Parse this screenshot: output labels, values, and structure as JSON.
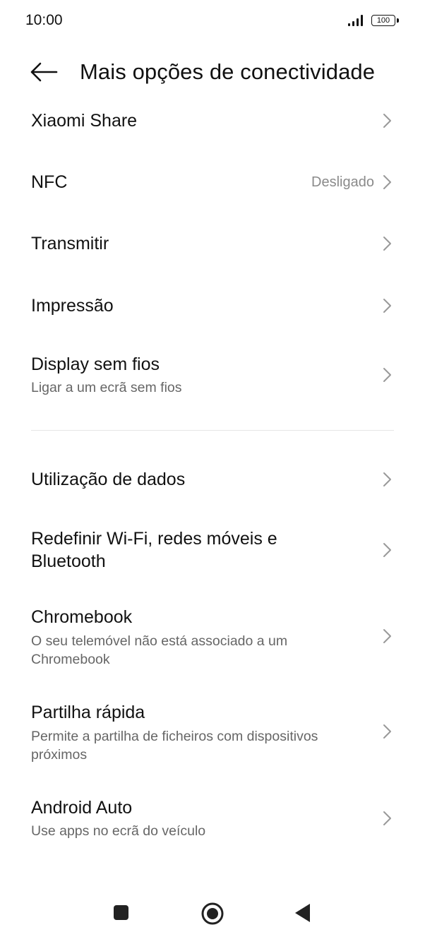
{
  "status_bar": {
    "time": "10:00",
    "battery": "100"
  },
  "header": {
    "title": "Mais opções de conectividade"
  },
  "items": [
    {
      "title": "Xiaomi Share"
    },
    {
      "title": "NFC",
      "value": "Desligado"
    },
    {
      "title": "Transmitir"
    },
    {
      "title": "Impressão"
    },
    {
      "title": "Display sem fios",
      "subtitle": "Ligar a um ecrã sem fios"
    },
    {
      "title": "Utilização de dados"
    },
    {
      "title": "Redefinir Wi-Fi, redes móveis e",
      "title_line2": "Bluetooth"
    },
    {
      "title": "Chromebook",
      "subtitle": "O seu telemóvel não está associado a um",
      "subtitle_line2": "Chromebook"
    },
    {
      "title": "Partilha rápida",
      "subtitle": "Permite a partilha de ficheiros com dispositivos",
      "subtitle_line2": "próximos"
    },
    {
      "title": "Android Auto",
      "subtitle": "Use apps no ecrã do veículo"
    }
  ],
  "icons": {
    "back": "arrow-left-icon",
    "chevron": "chevron-right-icon",
    "nav_recents": "square-icon",
    "nav_home": "circle-icon",
    "nav_back": "triangle-back-icon"
  }
}
